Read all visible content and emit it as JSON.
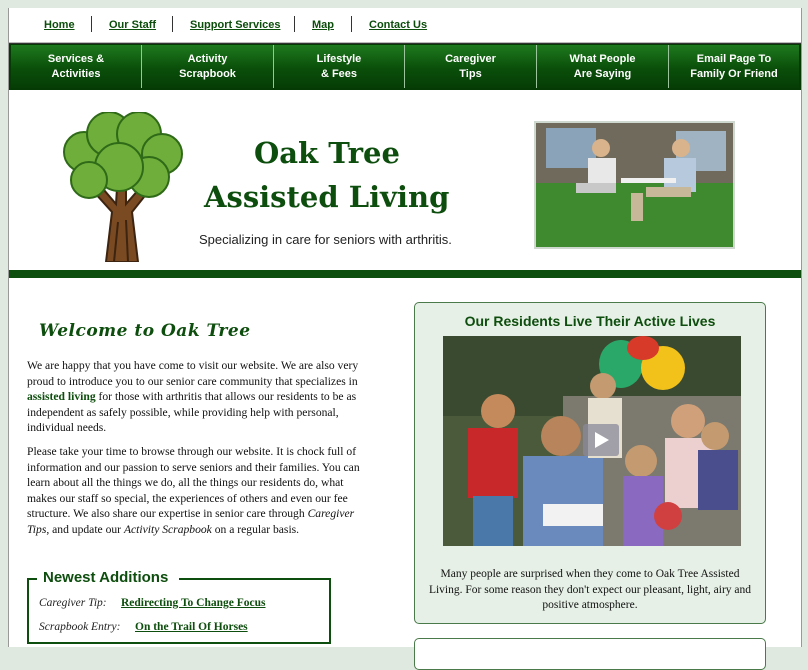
{
  "toplinks": {
    "home": "Home",
    "staff": "Our Staff",
    "support": "Support Services",
    "map": "Map",
    "contact": "Contact Us"
  },
  "nav": [
    {
      "label": "Services &\nActivities"
    },
    {
      "label": "Activity\nScrapbook"
    },
    {
      "label": "Lifestyle\n& Fees"
    },
    {
      "label": "Caregiver\nTips"
    },
    {
      "label": "What People\nAre Saying"
    },
    {
      "label": "Email Page To\nFamily Or Friend"
    }
  ],
  "header": {
    "title_line1": "Oak Tree",
    "title_line2": "Assisted Living",
    "subtitle": "Specializing in care for seniors with arthritis."
  },
  "welcome": {
    "heading": "Welcome to Oak Tree",
    "p1_a": "We are happy that you have come to visit our website. We are also very proud to introduce you to our senior care community that specializes in ",
    "p1_link": "assisted living",
    "p1_b": " for those with arthritis that allows our residents to be as independent as safely possible, while providing help with personal, individual needs.",
    "p2_a": "Please take your time to browse through our website. It is chock full of information and our passion to serve seniors and their families. You can learn about all the things we do, all the things our residents do, what makes our staff so special, the experiences of others and even our fee structure. We also share our expertise in senior care through ",
    "p2_em1": "Caregiver Tips",
    "p2_b": ", and update our ",
    "p2_em2": "Activity Scrapbook",
    "p2_c": " on a regular basis."
  },
  "newest": {
    "title": "Newest Additions",
    "items": [
      {
        "label": "Caregiver Tip:",
        "link": "Redirecting To Change Focus"
      },
      {
        "label": "Scrapbook Entry:",
        "link": "On the Trail Of Horses"
      }
    ]
  },
  "residents": {
    "title": "Our Residents Live Their Active Lives",
    "caption": "Many people are surprised when they come to Oak Tree Assisted Living. For some reason they don't expect our pleasant, light, airy and positive atmosphere."
  },
  "colors": {
    "brand_green": "#0d4d0d",
    "nav_green": "#0a4e0a",
    "panel_bg": "#e6f0e6"
  }
}
